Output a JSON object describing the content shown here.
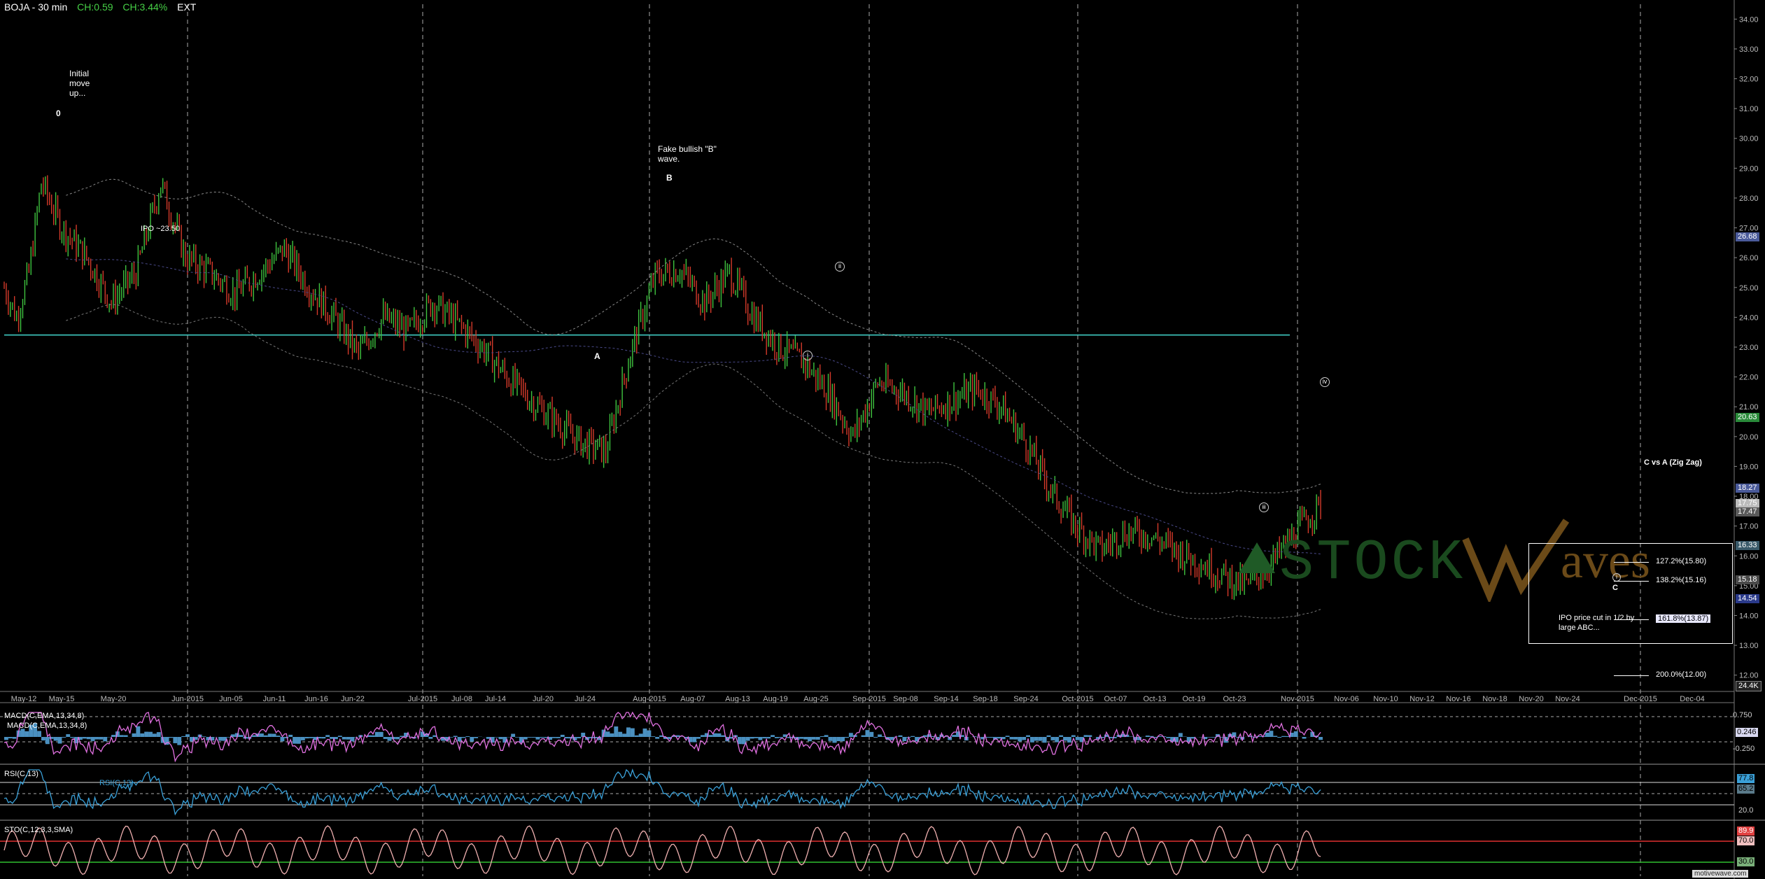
{
  "header": {
    "symbol": "BOJA - 30 min",
    "change": "CH:0.59",
    "change_pct": "CH:3.44%",
    "session": "EXT"
  },
  "chart_data": {
    "type": "line",
    "title": "BOJA - 30 min",
    "x_ticks": [
      "May-12",
      "May-15",
      "May-20",
      "Jun-2015",
      "Jun-05",
      "Jun-11",
      "Jun-16",
      "Jun-22",
      "Jul-2015",
      "Jul-08",
      "Jul-14",
      "Jul-20",
      "Jul-24",
      "Aug-2015",
      "Aug-07",
      "Aug-13",
      "Aug-19",
      "Aug-25",
      "Sep-2015",
      "Sep-08",
      "Sep-14",
      "Sep-18",
      "Sep-24",
      "Oct-2015",
      "Oct-07",
      "Oct-13",
      "Oct-19",
      "Oct-23",
      "Nov-2015",
      "Nov-06",
      "Nov-10",
      "Nov-12",
      "Nov-16",
      "Nov-18",
      "Nov-20",
      "Nov-24",
      "Dec-2015",
      "Dec-04"
    ],
    "y_ticks": [
      "34.00",
      "33.00",
      "32.00",
      "31.00",
      "30.00",
      "29.00",
      "28.00",
      "27.00",
      "26.00",
      "25.00",
      "24.00",
      "23.00",
      "22.00",
      "21.00",
      "20.00",
      "19.00",
      "18.00",
      "17.00",
      "16.00",
      "15.00",
      "14.00",
      "13.00",
      "12.00"
    ],
    "ylim": [
      11.5,
      34.5
    ],
    "price_path_index": [
      0,
      6,
      12,
      18,
      28,
      40,
      52,
      64,
      76,
      88,
      100,
      112,
      124,
      136,
      148,
      160,
      172,
      184,
      196,
      208,
      220,
      232,
      244,
      256,
      268,
      280,
      292,
      304,
      316,
      328,
      340,
      352,
      364,
      376,
      388,
      400,
      412,
      424,
      436,
      448,
      460,
      472,
      484,
      496,
      508,
      520,
      532,
      544,
      556,
      568,
      580,
      592,
      604,
      616,
      628,
      640
    ],
    "price_path_close": [
      25.0,
      24.0,
      25.5,
      28.5,
      27.0,
      26.0,
      24.5,
      25.5,
      28.5,
      26.0,
      25.5,
      24.8,
      25.5,
      26.3,
      25.0,
      24.0,
      22.8,
      24.0,
      23.5,
      24.5,
      23.8,
      23.0,
      22.0,
      21.2,
      20.5,
      19.8,
      19.5,
      22.8,
      25.4,
      25.6,
      24.5,
      25.5,
      24.0,
      23.0,
      22.5,
      21.5,
      20.0,
      21.8,
      21.5,
      20.8,
      21.2,
      21.6,
      21.0,
      19.8,
      18.2,
      17.0,
      16.2,
      16.8,
      16.7,
      16.2,
      15.8,
      15.3,
      15.0,
      15.8,
      16.9,
      17.8
    ],
    "ipo_level": 23.5,
    "fib_levels": [
      {
        "label": "127.2%(15.80)",
        "value": 15.8
      },
      {
        "label": "138.2%(15.16)",
        "value": 15.16
      },
      {
        "label": "161.8%(13.87)",
        "value": 13.87
      },
      {
        "label": "200.0%(12.00)",
        "value": 12.0
      }
    ],
    "price_tags": [
      {
        "text": "26.68",
        "value": 26.68,
        "color": "#4a5a9a"
      },
      {
        "text": "20.63",
        "value": 20.63,
        "color": "#2a8a3a"
      },
      {
        "text": "18.27",
        "value": 18.27,
        "color": "#4a5a9a"
      },
      {
        "text": "17.75",
        "value": 17.75,
        "color": "#bbbbbb"
      },
      {
        "text": "17.47",
        "value": 17.47,
        "color": "#5a5a5a"
      },
      {
        "text": "16.33",
        "value": 16.33,
        "color": "#3a5a6a"
      },
      {
        "text": "15.18",
        "value": 15.18,
        "color": "#4a4a4a"
      },
      {
        "text": "14.54",
        "value": 14.54,
        "color": "#2a3a8a"
      }
    ],
    "volume_tag": "24.4K"
  },
  "annotations": {
    "initial": "Initial\nmove\nup...",
    "wave0": "0",
    "fake_b": "Fake bullish \"B\"\nwave.",
    "waveB": "B",
    "waveA": "A",
    "ipo": "IPO ~23.50",
    "waveC": "C",
    "ipo_cut": "IPO price cut in 1/2 by\nlarge ABC...",
    "fib_title": "C vs A (Zig Zag)",
    "w1": "i",
    "w2": "ii",
    "w3": "iii",
    "w4": "iv",
    "wc_small": "i"
  },
  "watermark": {
    "left": "STOCK",
    "right": "aves"
  },
  "panels": {
    "macd": {
      "label1": "MACD(C,EMA,13,34,8)",
      "label2": "MACD(C,EMA,13,34,8)",
      "ticks": [
        "0.750",
        "0.250",
        "-0.250"
      ],
      "value": "0.246"
    },
    "rsi": {
      "label1": "RSI(C,13)",
      "label2": "RSI(C,13)",
      "ticks": [
        "80.0",
        "20.0"
      ],
      "value1": "77.8",
      "value2": "65.2"
    },
    "sto": {
      "label1": "STO(C,12,3,3,SMA)",
      "ticks": [
        "30.0"
      ],
      "value1": "89.9",
      "value2": "70.0"
    }
  },
  "footer": "motivewave.com",
  "colors": {
    "bull": "#3fc33f",
    "bear": "#d43a2a",
    "ipo_line": "#3ec8c0",
    "macd": "#e070e0",
    "rsi": "#3aa0d8",
    "sto": "#f0b0b0",
    "hist": "#4a90c0"
  }
}
